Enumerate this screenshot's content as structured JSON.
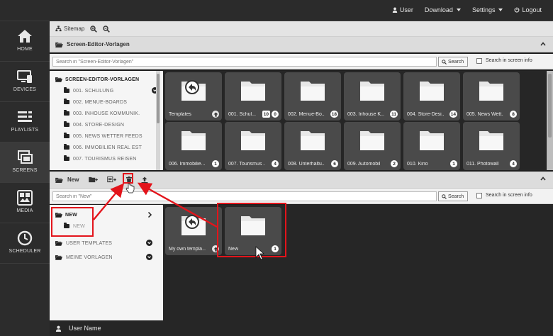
{
  "topnav": {
    "user": "User",
    "download": "Download",
    "settings": "Settings",
    "logout": "Logout"
  },
  "sidebar": {
    "items": [
      {
        "label": "HOME",
        "icon": "home-icon"
      },
      {
        "label": "DEVICES",
        "icon": "devices-icon"
      },
      {
        "label": "PLAYLISTS",
        "icon": "playlists-icon"
      },
      {
        "label": "SCREENS",
        "icon": "screens-icon"
      },
      {
        "label": "MEDIA",
        "icon": "media-icon"
      },
      {
        "label": "SCHEDULER",
        "icon": "scheduler-icon"
      }
    ],
    "active": "SCREENS"
  },
  "toolbar": {
    "sitemap": "Sitemap"
  },
  "upper": {
    "title": "Screen-Editor-Vorlagen",
    "search_placeholder": "Search in \"Screen-Editor-Vorlagen\"",
    "search_button": "Search",
    "search_screen_info": "Search in screen info",
    "tree_root": "SCREEN-EDITOR-VORLAGEN",
    "tree": [
      "001. SCHULUNG",
      "002. MENUE-BOARDS",
      "003. INHOUSE KOMMUNIK.",
      "004. STORE-DESIGN",
      "005. NEWS WETTER FEEDS",
      "006. IMMOBILIEN REAL EST",
      "007. TOURISMUS REISEN"
    ],
    "tiles": [
      {
        "name": "Templates",
        "type": "back",
        "badges": []
      },
      {
        "name": "001. Schul...",
        "badges": [
          "10",
          "0"
        ]
      },
      {
        "name": "002. Menue-Bo...",
        "badges": [
          "18"
        ]
      },
      {
        "name": "003. Inhouse K...",
        "badges": [
          "11"
        ]
      },
      {
        "name": "004. Store-Desi...",
        "badges": [
          "14"
        ]
      },
      {
        "name": "005. News Wett...",
        "badges": [
          "8"
        ]
      },
      {
        "name": "006. Immobilie...",
        "badges": [
          "1"
        ]
      },
      {
        "name": "007. Tourismus ...",
        "badges": [
          "4"
        ]
      },
      {
        "name": "008. Unterhaltu...",
        "badges": [
          "6"
        ]
      },
      {
        "name": "009. Automobil",
        "badges": [
          "2"
        ]
      },
      {
        "name": "010. Kino",
        "badges": [
          "1"
        ]
      },
      {
        "name": "011. Photowall",
        "badges": [
          "4"
        ]
      }
    ]
  },
  "lower": {
    "title": "New",
    "search_placeholder": "Search in \"New\"",
    "search_button": "Search",
    "search_screen_info": "Search in screen info",
    "tree_root": "NEW",
    "tree_child": "NEW",
    "tree_other": [
      "USER TEMPLATES",
      "MEINE VORLAGEN"
    ],
    "tiles": [
      {
        "name": "My own templa...",
        "type": "back",
        "badges": []
      },
      {
        "name": "New",
        "badges": [
          "1"
        ]
      }
    ]
  },
  "bottombar": {
    "username": "User Name"
  },
  "colors": {
    "highlight": "#e3141b",
    "tile": "#4a4a4a",
    "sidebar": "#2c2c2c"
  }
}
